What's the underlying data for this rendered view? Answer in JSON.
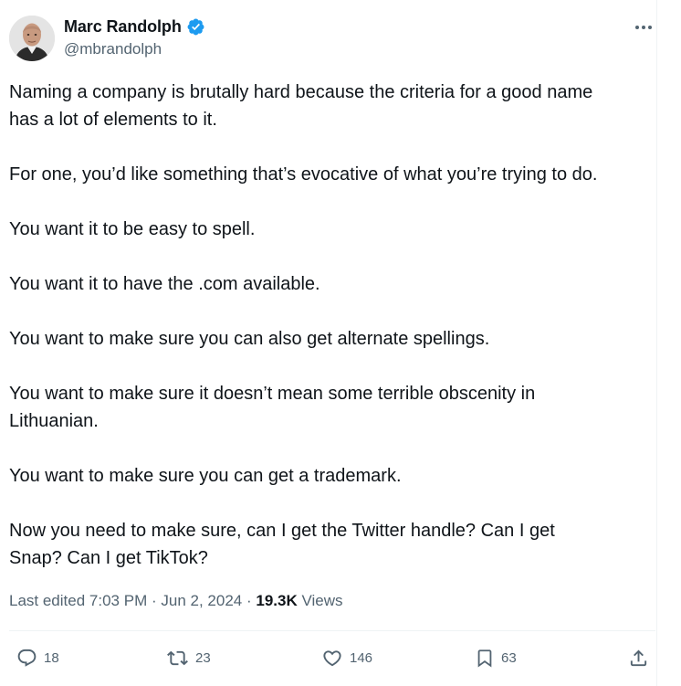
{
  "user": {
    "display_name": "Marc Randolph",
    "handle": "@mbrandolph",
    "verified_icon": "verified-badge-icon",
    "brand_color": "#1d9bf0"
  },
  "tweet": {
    "paragraphs": [
      "Naming a company is brutally hard because the criteria for a good name\nhas a lot of elements to it.",
      "For one, you’d like something that’s evocative of what you’re trying to do.",
      "You want it to be easy to spell.",
      "You want it to have the .com available.",
      "You want to make sure you can also get alternate spellings.",
      "You want to make sure it doesn’t mean some terrible obscenity in\nLithuanian.",
      "You want to make sure you can get a trademark.",
      "Now you need to make sure, can I get the Twitter handle? Can I get\nSnap? Can I get TikTok?"
    ]
  },
  "meta": {
    "edited_label": "Last edited",
    "time": "7:03 PM",
    "date": "Jun 2, 2024",
    "separator": "·",
    "views_count": "19.3K",
    "views_label": "Views"
  },
  "actions": {
    "replies": "18",
    "reposts": "23",
    "likes": "146",
    "bookmarks": "63"
  },
  "colors": {
    "text_primary": "#0f1419",
    "text_secondary": "#536471",
    "divider": "#eff3f4"
  }
}
